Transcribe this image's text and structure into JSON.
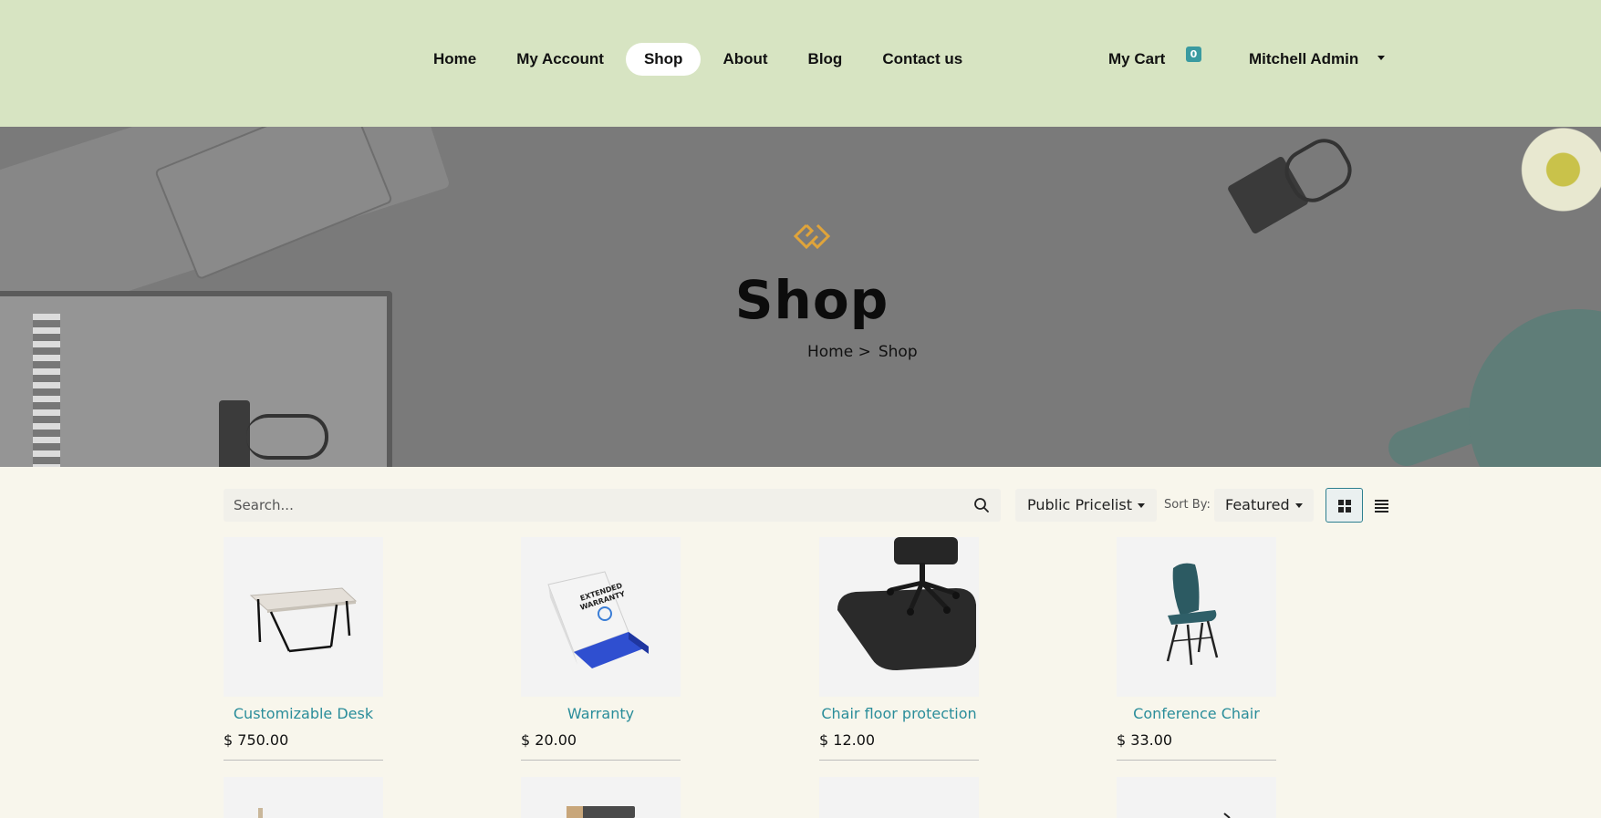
{
  "nav": {
    "items": [
      {
        "label": "Home",
        "active": false
      },
      {
        "label": "My Account",
        "active": false
      },
      {
        "label": "Shop",
        "active": true
      },
      {
        "label": "About",
        "active": false
      },
      {
        "label": "Blog",
        "active": false
      },
      {
        "label": "Contact us",
        "active": false
      }
    ],
    "cart_label": "My Cart",
    "cart_count": "0",
    "user_name": "Mitchell Admin"
  },
  "hero": {
    "title": "Shop",
    "breadcrumb": {
      "home": "Home >",
      "current": "Shop"
    },
    "logo_color": "#e0a43a"
  },
  "toolbar": {
    "search_placeholder": "Search...",
    "pricelist": "Public Pricelist",
    "sort_label": "Sort By:",
    "sort_value": "Featured",
    "view_mode": "grid"
  },
  "products": [
    {
      "name": "Customizable Desk",
      "price": "$ 750.00",
      "image": "desk-image"
    },
    {
      "name": "Warranty",
      "price": "$ 20.00",
      "image": "warranty-box-image"
    },
    {
      "name": "Chair floor protection",
      "price": "$ 12.00",
      "image": "chair-mat-image"
    },
    {
      "name": "Conference Chair",
      "price": "$ 33.00",
      "image": "chair-image"
    }
  ],
  "colors": {
    "header_bg": "#d7e4c2",
    "page_bg": "#f8f6ec",
    "accent": "#2a8d9a",
    "badge": "#3a9aa0"
  }
}
